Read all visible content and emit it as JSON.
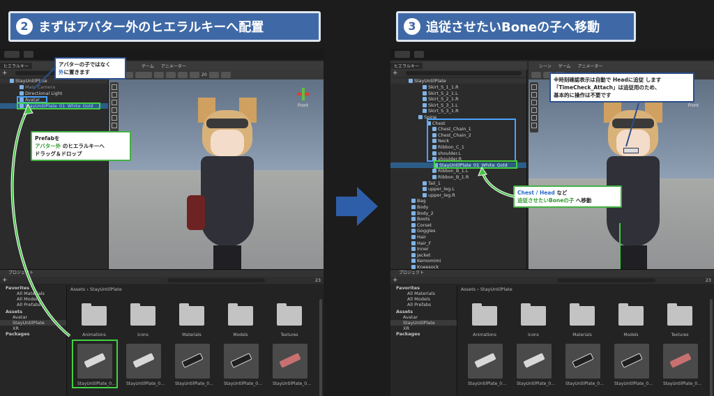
{
  "left": {
    "title_num": "2",
    "title": "まずはアバター外のヒエラルキーへ配置",
    "tabs": [
      "ヒエラルキー",
      "ゲーム",
      "アニメーター"
    ],
    "scene_root": "StayUntilPlate",
    "hier_rows": [
      "Main Camera",
      "Directional Light",
      "Avatar",
      "StayUntilPlate_01_White_Gold"
    ],
    "callout_top": {
      "line1": "アバターの子ではなく",
      "line2_em": "外",
      "line2_rest": "に置きます"
    },
    "callout_prefab": {
      "line1": "Prefabを",
      "line2_em": "アバター外",
      "line2_rest": "のヒエラルキーへ",
      "line3": "ドラッグ＆ドロップ"
    },
    "front_label": "Front",
    "project_tab": "プロジェクト",
    "tree": [
      "Favorites",
      "All Materials",
      "All Models",
      "All Prefabs",
      "Assets",
      "Avatar",
      "StayUntilPlate",
      "XR",
      "Packages"
    ],
    "breadcrumb": {
      "a": "Assets",
      "b": "StayUntilPlate"
    },
    "folders": [
      "Animations",
      "Icons",
      "Materials",
      "Models",
      "Textures"
    ],
    "prefab_labels": [
      "StayUntilPlate_0…",
      "StayUntilPlate_0…",
      "StayUntilPlate_0…",
      "StayUntilPlate_0…",
      "StayUntilPlate_0…"
    ],
    "count": "23",
    "ortho": "20"
  },
  "right": {
    "title_num": "3",
    "title": "追従させたいBoneの子へ移動",
    "tabs": [
      "ヒエラルキー",
      "シーン",
      "ゲーム",
      "アニメーター"
    ],
    "scene_root": "StayUntilPlate",
    "hier_rows": [
      "Skirt_S_1_1.R",
      "Skirt_S_2_1.L",
      "Skirt_S_2_1.R",
      "Skirt_S_3_1.L",
      "Skirt_S_3_1.R",
      "Spine",
      "Chest",
      "Chest_Chain_1",
      "Chest_Chain_2",
      "Neck",
      "Ribbon_C_1",
      "shoulder.L",
      "shoulder.R",
      "StayUntilPlate_01_White_Gold",
      "Ribbon_B_1.L",
      "Ribbon_B_1.R",
      "Tail_1",
      "upper_leg.L",
      "upper_leg.R",
      "Bag",
      "Body",
      "Body_2",
      "Boots",
      "Corset",
      "Goggles",
      "Hair",
      "Hair_F",
      "Inner",
      "Jacket",
      "Kemomimi",
      "Kneesock"
    ],
    "callout_top": {
      "line1_pre": "※時刻確認表示は自動で Headに追従 します",
      "line2": "「TimeCheck_Attach」は追従用のため、",
      "line3": "基本的に操作は不要です"
    },
    "callout_move": {
      "line1_a": "Chest / Head",
      "line1_b": "など",
      "line2_em": "追従させたいBoneの子",
      "line2_rest": "へ移動"
    },
    "front_label": "Front",
    "project_tab": "プロジェクト",
    "tree": [
      "Favorites",
      "All Materials",
      "All Models",
      "All Prefabs",
      "Assets",
      "Avatar",
      "StayUntilPlate",
      "XR",
      "Packages"
    ],
    "breadcrumb": {
      "a": "Assets",
      "b": "StayUntilPlate"
    },
    "folders": [
      "Animations",
      "Icons",
      "Materials",
      "Models",
      "Textures"
    ],
    "prefab_labels": [
      "StayUntilPlate_0…",
      "StayUntilPlate_0…",
      "StayUntilPlate_0…",
      "StayUntilPlate_0…",
      "StayUntilPlate_0…"
    ],
    "count": "23"
  },
  "colors": {
    "accent_blue": "#3f69a6",
    "callout_green": "#44b044",
    "arrow_blue": "#2f5ea8"
  }
}
